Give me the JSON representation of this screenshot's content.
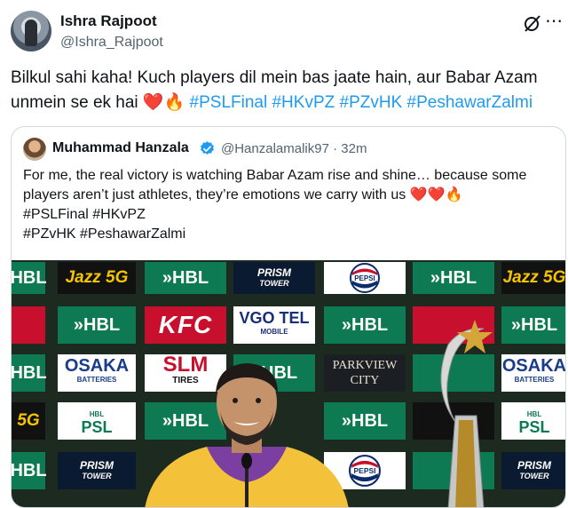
{
  "tweet": {
    "author_name": "Ishra Rajpoot",
    "author_handle": "@Ishra_Rajpoot",
    "text_line1": "Bilkul sahi kaha! Kuch players dil mein bas jaate hain, aur Babar Azam",
    "text_line2_prefix": "unmein se ek hai ",
    "emojis": "❤️🔥",
    "hashtags": [
      "#PSLFinal",
      "#HKvPZ",
      "#PZvHK",
      "#PeshawarZalmi"
    ]
  },
  "quote": {
    "author_name": "Muhammad Hanzala",
    "author_handle": "@Hanzalamalik97 · 32m",
    "line1": "For me, the real victory is watching Babar Azam rise and shine… because some",
    "line2": "players aren’t just athletes, they’re emotions we carry with us ❤️❤️🔥",
    "line3": "#PSLFinal #HKvPZ",
    "line4": "#PZvHK #PeshawarZalmi"
  },
  "media": {
    "sponsors": {
      "hbl": "HBL",
      "jazz": "Jazz 5G",
      "prism_top": "PRISM",
      "prism_bottom": "TOWER",
      "pepsi": "PEPSI",
      "kfc": "KFC",
      "vgo_top": "VGO TEL",
      "vgo_bottom": "MOBILE",
      "osaka_top": "OSAKA",
      "osaka_bottom": "BATTERIES",
      "slm_top": "SLM",
      "slm_bottom": "TIRES",
      "park_top": "PARKVIEW",
      "park_bottom": "CITY",
      "psl_top": "HBL",
      "psl_bottom": "PSL"
    }
  },
  "colors": {
    "hashtag": "#1d9bf0",
    "verified": "#1d9bf0",
    "secondary_text": "#536471",
    "hbl_green": "#0d7a53",
    "kfc_red": "#c8102e"
  },
  "icons": [
    "grok-icon",
    "more-icon",
    "verified-icon"
  ]
}
